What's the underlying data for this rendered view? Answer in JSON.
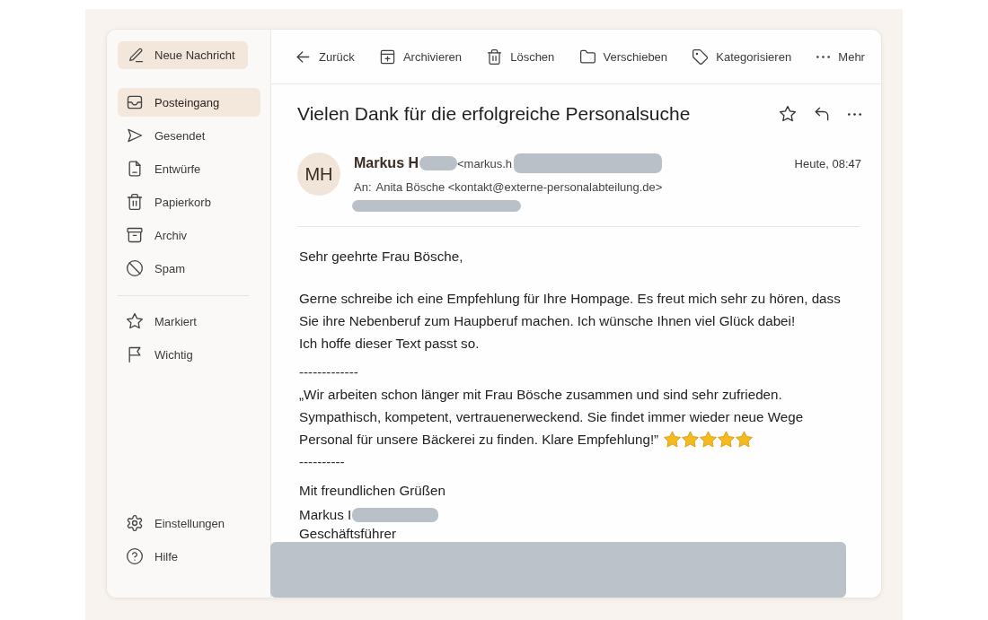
{
  "sidebar": {
    "compose": {
      "label": "Neue Nachricht"
    },
    "folders": [
      {
        "label": "Posteingang",
        "selected": true
      },
      {
        "label": "Gesendet",
        "selected": false
      },
      {
        "label": "Entwürfe",
        "selected": false
      },
      {
        "label": "Papierkorb",
        "selected": false
      },
      {
        "label": "Archiv",
        "selected": false
      },
      {
        "label": "Spam",
        "selected": false
      }
    ],
    "flags": [
      {
        "label": "Markiert",
        "selected": false
      },
      {
        "label": "Wichtig",
        "selected": false
      }
    ],
    "footer": [
      {
        "label": "Einstellungen"
      },
      {
        "label": "Hilfe"
      }
    ]
  },
  "toolbar": [
    {
      "label": "Zurück"
    },
    {
      "label": "Archivieren"
    },
    {
      "label": "Löschen"
    },
    {
      "label": "Verschieben"
    },
    {
      "label": "Kategorisieren"
    },
    {
      "label": "Mehr"
    }
  ],
  "message": {
    "subject": "Vielen Dank für die erfolgreiche Personalsuche",
    "sender": {
      "initials": "MH",
      "name": "Markus H",
      "name_redacted": true,
      "address": "<markus.h",
      "address_redacted": true
    },
    "date": "Heute, 08:47",
    "recipient": {
      "label": "An:",
      "value": "Anita Bösche <kontakt@externe-personalabteilung.de>"
    },
    "extra_line_redacted": true,
    "body": [
      {
        "kind": "paragraph",
        "lines": [
          "Sehr geehrte Frau Bösche,"
        ]
      },
      {
        "kind": "paragraph",
        "lines": [
          "Gerne schreibe ich eine Empfehlung für Ihre Hompage. Es freut mich sehr zu hören, dass",
          "Sie ihre Nebenberuf zum Haupberuf machen. Ich wünsche Ihnen viel Glück dabei!",
          "Ich hoffe dieser Text passt so."
        ]
      },
      {
        "kind": "separator",
        "lines": [
          "-------------"
        ]
      },
      {
        "kind": "quote",
        "lines": [
          "„Wir arbeiten schon länger mit Frau Bösche zusammen und sind sehr zufrieden.",
          "Sympathisch, kompetent, vertrauenerweckend. Sie findet immer wieder neue Wege",
          "Personal für unsere Bäckerei zu finden. Klare Empfehlung!”"
        ],
        "stars": 5
      },
      {
        "kind": "separator",
        "lines": [
          "----------"
        ]
      },
      {
        "kind": "paragraph",
        "lines": [
          "Mit freundlichen Grüßen"
        ]
      }
    ],
    "signature": [
      {
        "text": "Markus I",
        "redacted": true
      },
      {
        "text": "Geschäftsführer",
        "redacted": false
      }
    ],
    "footer_redacted": true
  }
}
